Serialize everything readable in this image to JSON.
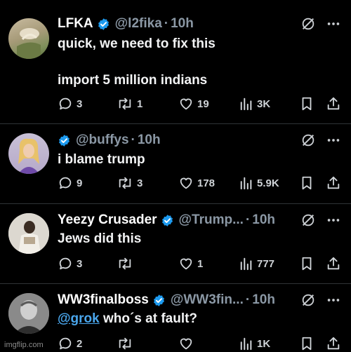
{
  "tweets": [
    {
      "name": "LFKA",
      "handle": "@l2fika",
      "time": "10h",
      "text_line1": "quick, we need to fix this",
      "text_line2": "import 5 million indians",
      "replies": "3",
      "reposts": "1",
      "likes": "19",
      "views": "3K"
    },
    {
      "name": "",
      "handle": "@buffys",
      "time": "10h",
      "text": "i blame trump",
      "replies": "9",
      "reposts": "3",
      "likes": "178",
      "views": "5.9K"
    },
    {
      "name": "Yeezy Crusader",
      "handle": "@Trump...",
      "time": "10h",
      "text": "Jews did this",
      "replies": "3",
      "reposts": "",
      "likes": "1",
      "views": "777"
    },
    {
      "name": "WW3finalboss",
      "handle": "@WW3fin...",
      "time": "10h",
      "mention": "@grok",
      "text": " who´s at fault?",
      "replies": "2",
      "reposts": "",
      "likes": "",
      "views": "1K"
    }
  ],
  "separator": "·",
  "watermark": "imgflip.com",
  "colors": {
    "background": "#000000",
    "verified": "#1d9bf0",
    "mention": "#4aa6ec",
    "muted": "#8b98a5"
  },
  "icons": [
    "verified-badge-icon",
    "grok-icon",
    "more-icon",
    "reply-icon",
    "repost-icon",
    "like-icon",
    "views-icon",
    "bookmark-icon",
    "share-icon"
  ]
}
